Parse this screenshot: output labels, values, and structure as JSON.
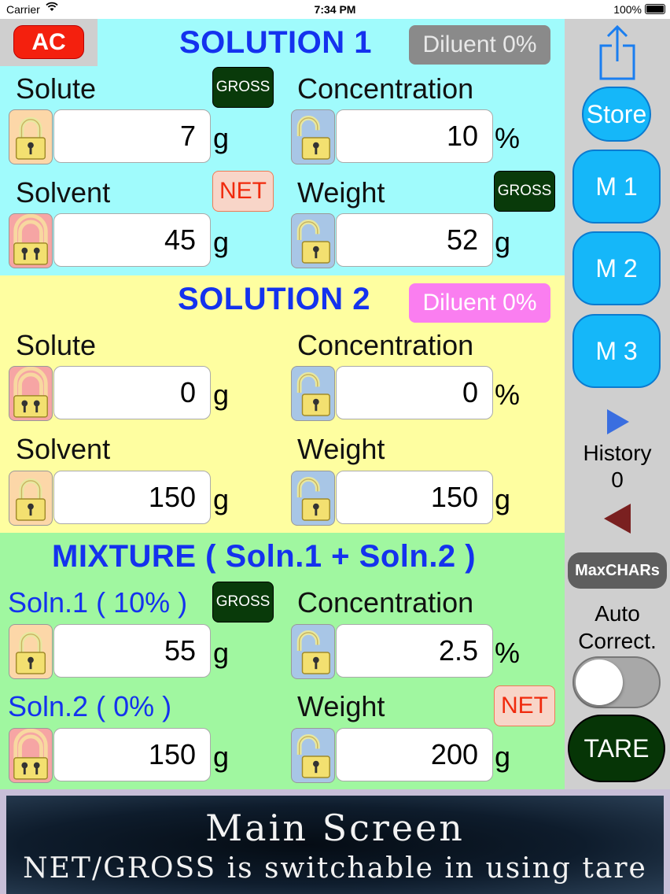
{
  "status_bar": {
    "carrier": "Carrier",
    "time": "7:34 PM",
    "battery": "100%"
  },
  "solution1": {
    "title": "SOLUTION 1",
    "ac_label": "AC",
    "diluent": "Diluent 0%",
    "solute_label": "Solute",
    "solute_badge": "GROSS",
    "solute_value": "7",
    "solute_unit": "g",
    "concentration_label": "Concentration",
    "concentration_value": "10",
    "concentration_unit": "%",
    "solvent_label": "Solvent",
    "solvent_badge": "NET",
    "solvent_value": "45",
    "solvent_unit": "g",
    "weight_label": "Weight",
    "weight_badge": "GROSS",
    "weight_value": "52",
    "weight_unit": "g"
  },
  "solution2": {
    "title": "SOLUTION 2",
    "diluent": "Diluent 0%",
    "solute_label": "Solute",
    "solute_value": "0",
    "solute_unit": "g",
    "concentration_label": "Concentration",
    "concentration_value": "0",
    "concentration_unit": "%",
    "solvent_label": "Solvent",
    "solvent_value": "150",
    "solvent_unit": "g",
    "weight_label": "Weight",
    "weight_value": "150",
    "weight_unit": "g"
  },
  "mixture": {
    "title": "MIXTURE ( Soln.1 + Soln.2 )",
    "soln1_label": "Soln.1 ( 10% )",
    "soln1_badge": "GROSS",
    "soln1_value": "55",
    "soln1_unit": "g",
    "concentration_label": "Concentration",
    "concentration_value": "2.5",
    "concentration_unit": "%",
    "soln2_label": "Soln.2 ( 0% )",
    "soln2_value": "150",
    "soln2_unit": "g",
    "weight_label": "Weight",
    "weight_badge": "NET",
    "weight_value": "200",
    "weight_unit": "g"
  },
  "sidebar": {
    "share_icon": "share-icon",
    "store_label": "Store",
    "m1_label": "M 1",
    "m2_label": "M 2",
    "m3_label": "M 3",
    "history_label": "History",
    "history_count": "0",
    "maxchars_label": "MaxCHARs",
    "auto_correct_line1": "Auto",
    "auto_correct_line2": "Correct.",
    "auto_correct_on": false,
    "tare_label": "TARE"
  },
  "banner": {
    "line1": "Main Screen",
    "line2": "NET/GROSS is switchable in using tare"
  },
  "colors": {
    "solution1_bg": "#a0fbfc",
    "solution2_bg": "#fefea0",
    "mixture_bg": "#a0f7a0",
    "title_blue": "#1432ee",
    "button_blue": "#15b7f9",
    "tare_green": "#063506"
  }
}
